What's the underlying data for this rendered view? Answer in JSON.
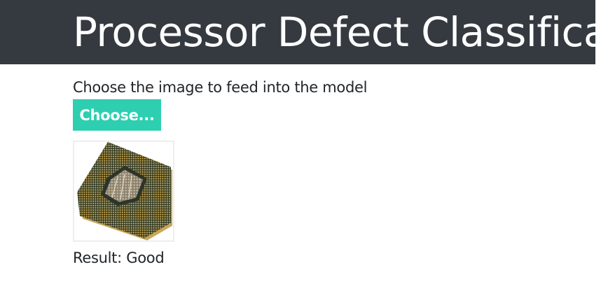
{
  "header": {
    "title": "Processor Defect Classification"
  },
  "main": {
    "prompt": "Choose the image to feed into the model",
    "choose_button_label": "Choose...",
    "result_label": "Result:",
    "result_value": "Good"
  },
  "image": {
    "subject": "processor-chip-photo"
  },
  "colors": {
    "header_bg": "#343a40",
    "button_bg": "#2ecfb0",
    "text": "#212529"
  }
}
